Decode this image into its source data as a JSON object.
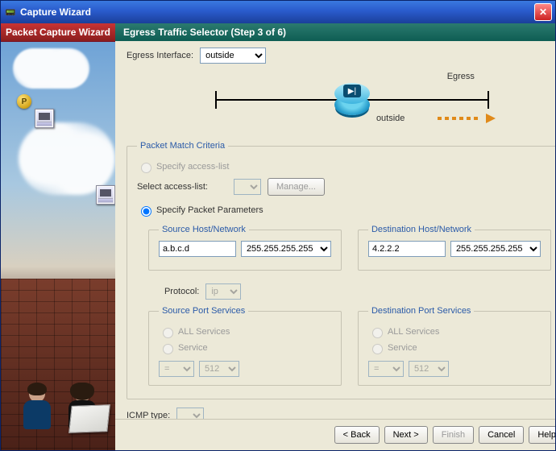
{
  "window": {
    "title": "Capture Wizard",
    "icon_glyph": "📟",
    "close_label": "✕"
  },
  "sidebar": {
    "header": "Packet Capture Wizard",
    "badge_label": "P"
  },
  "step_header": "Egress Traffic Selector   (Step 3 of 6)",
  "egress": {
    "label": "Egress Interface:",
    "selected": "outside",
    "diagram_label": "Egress",
    "interface_name": "outside"
  },
  "pmc": {
    "legend": "Packet Match Criteria",
    "opt_accesslist": "Specify access-list",
    "select_al_label": "Select access-list:",
    "manage_btn": "Manage...",
    "opt_params": "Specify Packet Parameters"
  },
  "src": {
    "legend": "Source Host/Network",
    "host": "a.b.c.d",
    "mask": "255.255.255.255"
  },
  "dst": {
    "legend": "Destination Host/Network",
    "host": "4.2.2.2",
    "mask": "255.255.255.255"
  },
  "protocol": {
    "label": "Protocol:",
    "value": "ip"
  },
  "sps": {
    "legend": "Source Port Services",
    "all": "ALL Services",
    "svc": "Service",
    "op": "=",
    "port": "512"
  },
  "dps": {
    "legend": "Destination Port Services",
    "all": "ALL Services",
    "svc": "Service",
    "op": "=",
    "port": "512"
  },
  "icmp": {
    "label": "ICMP type:"
  },
  "footer": {
    "back": "< Back",
    "next": "Next >",
    "finish": "Finish",
    "cancel": "Cancel",
    "help": "Help"
  }
}
